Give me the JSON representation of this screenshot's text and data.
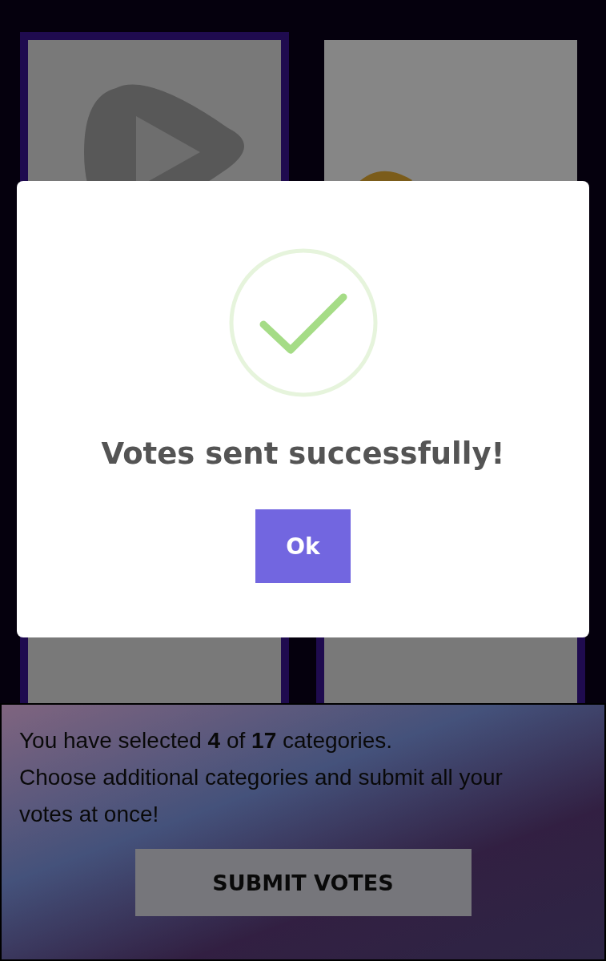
{
  "cards": [
    {
      "kind": "picture",
      "selected": true
    },
    {
      "kind": "picture",
      "selected": false
    },
    {
      "kind": "picture",
      "selected": true
    },
    {
      "kind": "picture",
      "selected": true
    }
  ],
  "footer": {
    "summary": "You have selected **4** of **17** categories.",
    "instruction": "Choose additional categories and submit all your votes at once!",
    "button": "SUBMIT VOTES"
  },
  "modal": {
    "message": "Votes sent successfully!",
    "button": "Ok"
  }
}
